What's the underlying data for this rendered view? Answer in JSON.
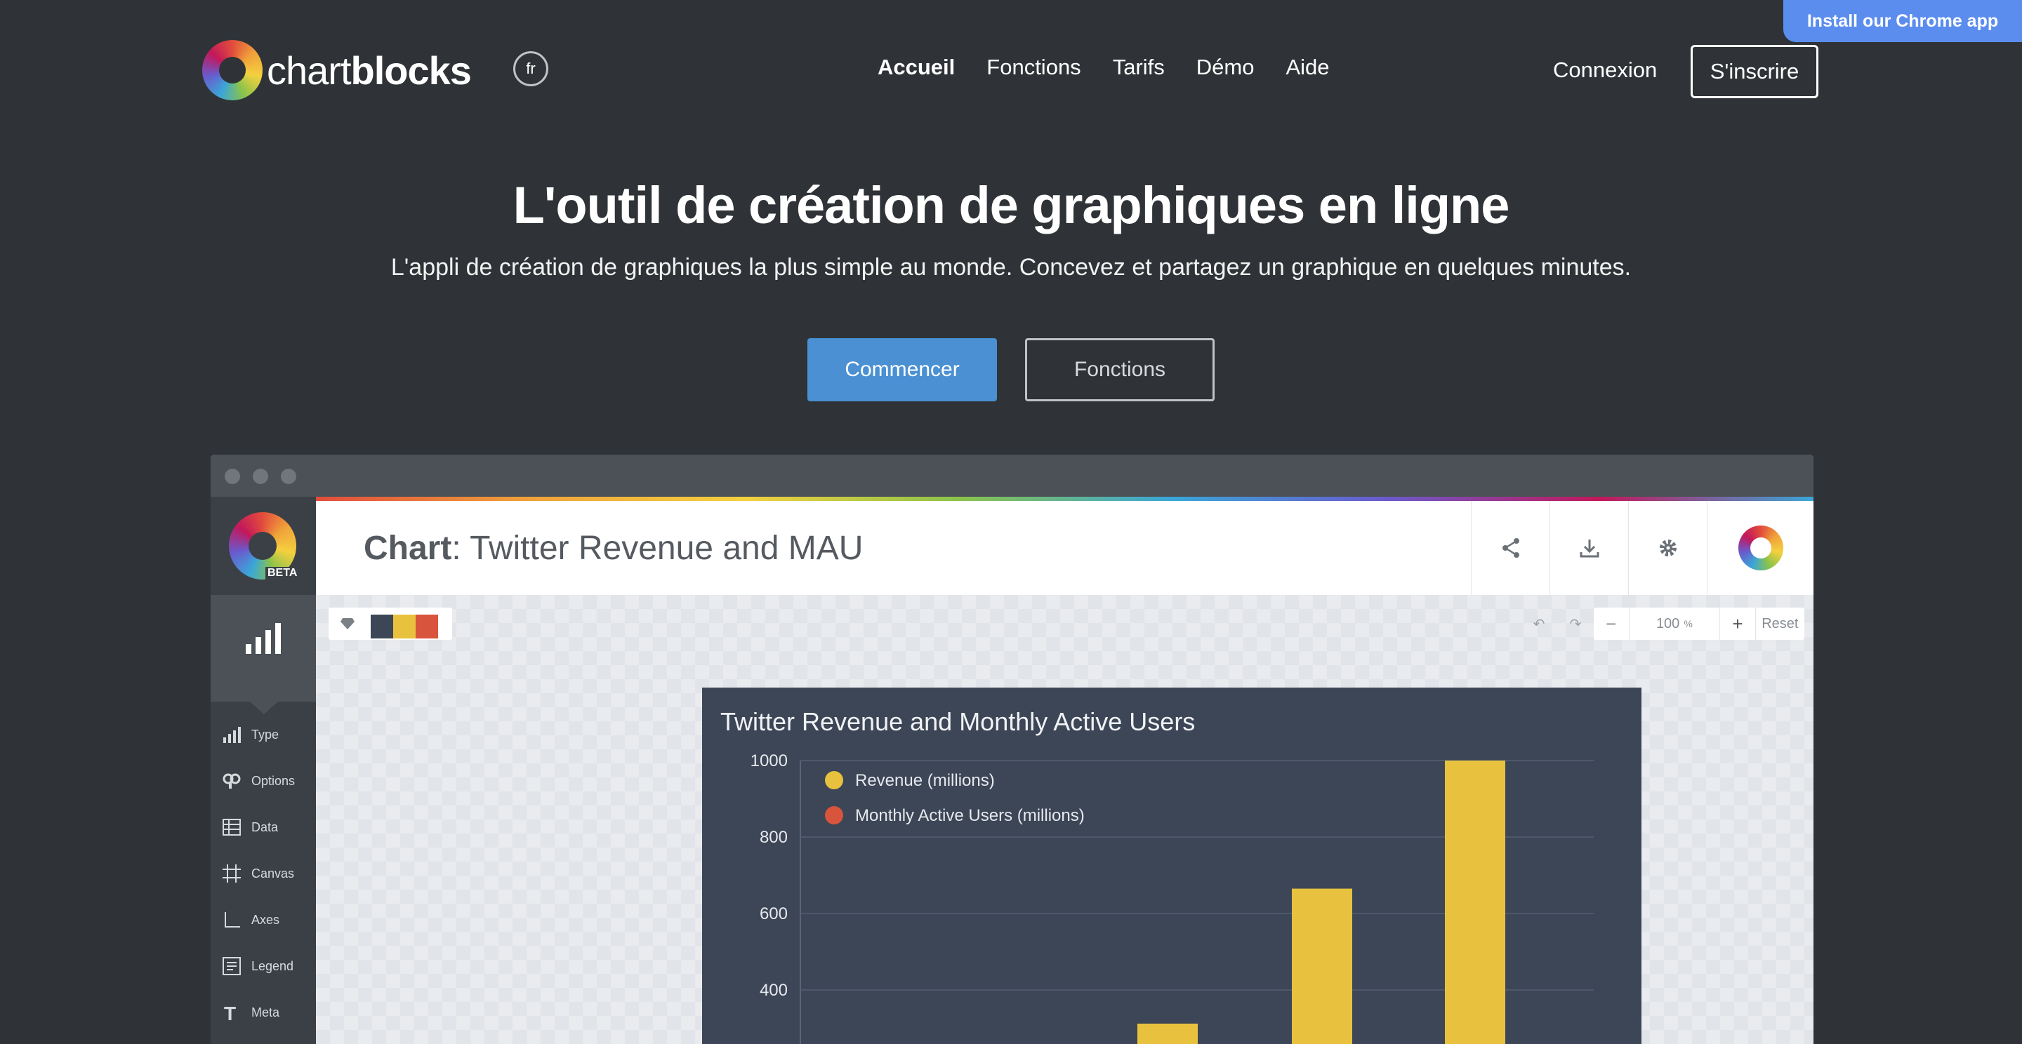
{
  "banner": {
    "chrome_app": "Install our Chrome app"
  },
  "header": {
    "logo_light": "chart",
    "logo_bold": "blocks",
    "language": "fr",
    "nav": [
      "Accueil",
      "Fonctions",
      "Tarifs",
      "Démo",
      "Aide"
    ],
    "login": "Connexion",
    "signup": "S'inscrire"
  },
  "hero": {
    "title": "L'outil de création de graphiques en ligne",
    "subtitle": "L'appli de création de graphiques la plus simple au monde. Concevez et partagez un graphique en quelques minutes.",
    "cta_primary": "Commencer",
    "cta_secondary": "Fonctions"
  },
  "app": {
    "beta": "BETA",
    "title_label": "Chart",
    "title_text": ": Twitter Revenue and MAU",
    "sidebar_items": [
      "Type",
      "Options",
      "Data",
      "Canvas",
      "Axes",
      "Legend",
      "Meta"
    ],
    "zoom_value": "100",
    "zoom_unit": "%",
    "reset": "Reset",
    "palette_colors": [
      "#3d4656",
      "#e8c23e",
      "#d9543c"
    ]
  },
  "chart_data": {
    "type": "bar",
    "title": "Twitter Revenue and Monthly Active Users",
    "ylim": [
      0,
      1000
    ],
    "yticks": [
      400,
      600,
      800,
      1000
    ],
    "grid": true,
    "legend_position": "top-left",
    "series": [
      {
        "name": "Revenue (millions)",
        "color": "#e8c23e",
        "values": [
          312,
          665,
          1000
        ]
      },
      {
        "name": "Monthly Active Users (millions)",
        "color": "#d9543c",
        "values": []
      }
    ]
  }
}
